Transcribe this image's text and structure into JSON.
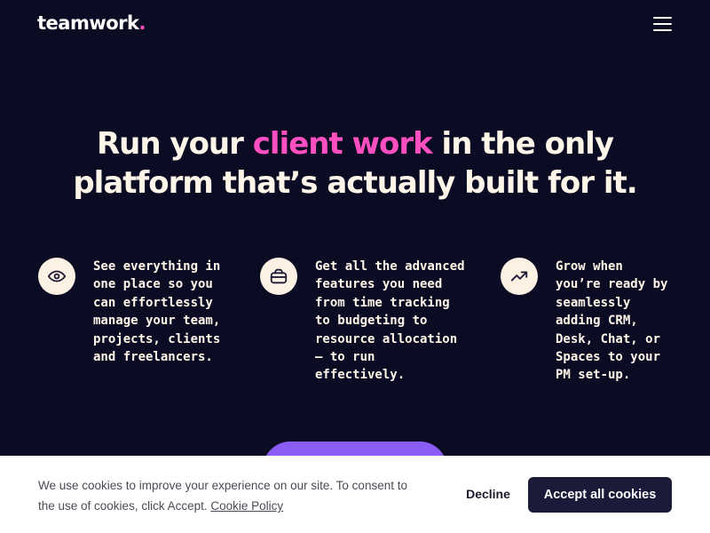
{
  "header": {
    "logo_text": "teamwork",
    "logo_dot": ".",
    "menu_icon": "hamburger-menu-icon"
  },
  "hero": {
    "title_part1": "Run your ",
    "title_accent": "client work",
    "title_part2": " in the only platform that’s actually built for it."
  },
  "features": [
    {
      "icon": "eye-icon",
      "text": "See everything in one place so you can effortlessly manage your team, projects, clients and freelancers."
    },
    {
      "icon": "briefcase-icon",
      "text": "Get all the advanced features you need from time tracking to budgeting to resource allocation — to run effectively."
    },
    {
      "icon": "trending-up-icon",
      "text": "Grow when you’re ready by seamlessly adding CRM, Desk, Chat, or Spaces to your PM set-up."
    }
  ],
  "cookie_banner": {
    "text": "We use cookies to improve your experience on our site. To consent to the use of cookies, click Accept. ",
    "link_label": "Cookie Policy",
    "decline_label": "Decline",
    "accept_label": "Accept all cookies"
  },
  "colors": {
    "background": "#0b0c24",
    "accent_pink": "#ff4fc0",
    "cream": "#fff6e9",
    "cta_purple": "#8b5cf6",
    "accept_button": "#1b1a38"
  }
}
